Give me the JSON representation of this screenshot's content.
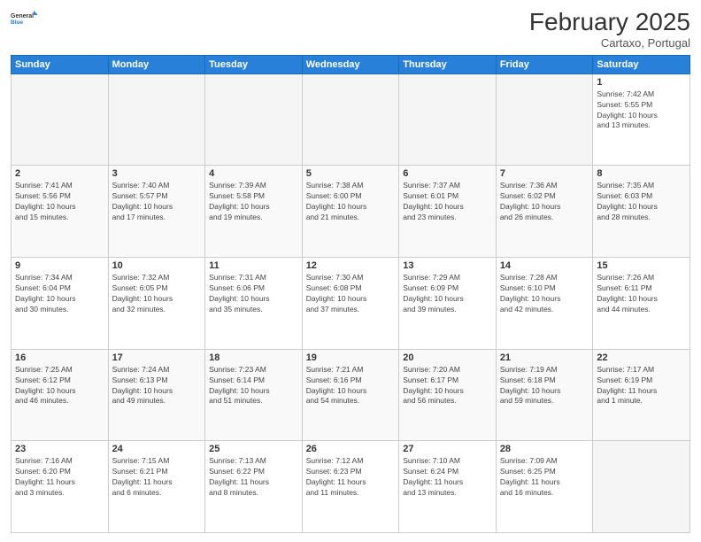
{
  "logo": {
    "text_general": "General",
    "text_blue": "Blue"
  },
  "header": {
    "month_title": "February 2025",
    "subtitle": "Cartaxo, Portugal"
  },
  "weekdays": [
    "Sunday",
    "Monday",
    "Tuesday",
    "Wednesday",
    "Thursday",
    "Friday",
    "Saturday"
  ],
  "weeks": [
    [
      {
        "day": "",
        "info": ""
      },
      {
        "day": "",
        "info": ""
      },
      {
        "day": "",
        "info": ""
      },
      {
        "day": "",
        "info": ""
      },
      {
        "day": "",
        "info": ""
      },
      {
        "day": "",
        "info": ""
      },
      {
        "day": "1",
        "info": "Sunrise: 7:42 AM\nSunset: 5:55 PM\nDaylight: 10 hours\nand 13 minutes."
      }
    ],
    [
      {
        "day": "2",
        "info": "Sunrise: 7:41 AM\nSunset: 5:56 PM\nDaylight: 10 hours\nand 15 minutes."
      },
      {
        "day": "3",
        "info": "Sunrise: 7:40 AM\nSunset: 5:57 PM\nDaylight: 10 hours\nand 17 minutes."
      },
      {
        "day": "4",
        "info": "Sunrise: 7:39 AM\nSunset: 5:58 PM\nDaylight: 10 hours\nand 19 minutes."
      },
      {
        "day": "5",
        "info": "Sunrise: 7:38 AM\nSunset: 6:00 PM\nDaylight: 10 hours\nand 21 minutes."
      },
      {
        "day": "6",
        "info": "Sunrise: 7:37 AM\nSunset: 6:01 PM\nDaylight: 10 hours\nand 23 minutes."
      },
      {
        "day": "7",
        "info": "Sunrise: 7:36 AM\nSunset: 6:02 PM\nDaylight: 10 hours\nand 26 minutes."
      },
      {
        "day": "8",
        "info": "Sunrise: 7:35 AM\nSunset: 6:03 PM\nDaylight: 10 hours\nand 28 minutes."
      }
    ],
    [
      {
        "day": "9",
        "info": "Sunrise: 7:34 AM\nSunset: 6:04 PM\nDaylight: 10 hours\nand 30 minutes."
      },
      {
        "day": "10",
        "info": "Sunrise: 7:32 AM\nSunset: 6:05 PM\nDaylight: 10 hours\nand 32 minutes."
      },
      {
        "day": "11",
        "info": "Sunrise: 7:31 AM\nSunset: 6:06 PM\nDaylight: 10 hours\nand 35 minutes."
      },
      {
        "day": "12",
        "info": "Sunrise: 7:30 AM\nSunset: 6:08 PM\nDaylight: 10 hours\nand 37 minutes."
      },
      {
        "day": "13",
        "info": "Sunrise: 7:29 AM\nSunset: 6:09 PM\nDaylight: 10 hours\nand 39 minutes."
      },
      {
        "day": "14",
        "info": "Sunrise: 7:28 AM\nSunset: 6:10 PM\nDaylight: 10 hours\nand 42 minutes."
      },
      {
        "day": "15",
        "info": "Sunrise: 7:26 AM\nSunset: 6:11 PM\nDaylight: 10 hours\nand 44 minutes."
      }
    ],
    [
      {
        "day": "16",
        "info": "Sunrise: 7:25 AM\nSunset: 6:12 PM\nDaylight: 10 hours\nand 46 minutes."
      },
      {
        "day": "17",
        "info": "Sunrise: 7:24 AM\nSunset: 6:13 PM\nDaylight: 10 hours\nand 49 minutes."
      },
      {
        "day": "18",
        "info": "Sunrise: 7:23 AM\nSunset: 6:14 PM\nDaylight: 10 hours\nand 51 minutes."
      },
      {
        "day": "19",
        "info": "Sunrise: 7:21 AM\nSunset: 6:16 PM\nDaylight: 10 hours\nand 54 minutes."
      },
      {
        "day": "20",
        "info": "Sunrise: 7:20 AM\nSunset: 6:17 PM\nDaylight: 10 hours\nand 56 minutes."
      },
      {
        "day": "21",
        "info": "Sunrise: 7:19 AM\nSunset: 6:18 PM\nDaylight: 10 hours\nand 59 minutes."
      },
      {
        "day": "22",
        "info": "Sunrise: 7:17 AM\nSunset: 6:19 PM\nDaylight: 11 hours\nand 1 minute."
      }
    ],
    [
      {
        "day": "23",
        "info": "Sunrise: 7:16 AM\nSunset: 6:20 PM\nDaylight: 11 hours\nand 3 minutes."
      },
      {
        "day": "24",
        "info": "Sunrise: 7:15 AM\nSunset: 6:21 PM\nDaylight: 11 hours\nand 6 minutes."
      },
      {
        "day": "25",
        "info": "Sunrise: 7:13 AM\nSunset: 6:22 PM\nDaylight: 11 hours\nand 8 minutes."
      },
      {
        "day": "26",
        "info": "Sunrise: 7:12 AM\nSunset: 6:23 PM\nDaylight: 11 hours\nand 11 minutes."
      },
      {
        "day": "27",
        "info": "Sunrise: 7:10 AM\nSunset: 6:24 PM\nDaylight: 11 hours\nand 13 minutes."
      },
      {
        "day": "28",
        "info": "Sunrise: 7:09 AM\nSunset: 6:25 PM\nDaylight: 11 hours\nand 16 minutes."
      },
      {
        "day": "",
        "info": ""
      }
    ]
  ]
}
